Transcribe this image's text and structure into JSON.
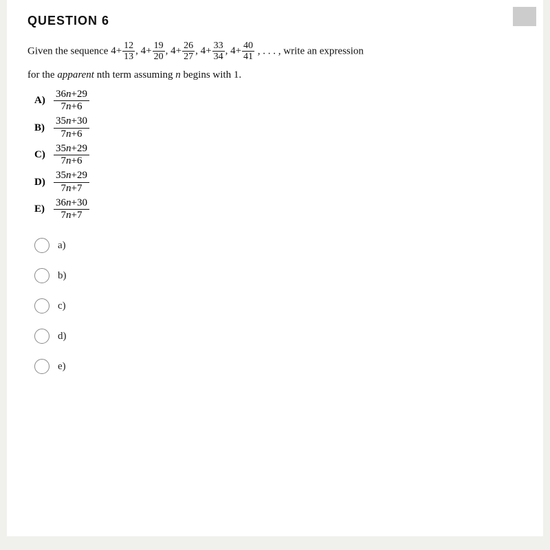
{
  "title": "QUESTION 6",
  "question": {
    "intro": "Given the sequence",
    "sequence": [
      {
        "whole": "4+",
        "num": "12",
        "den": "13"
      },
      {
        "whole": "4+",
        "num": "19",
        "den": "20"
      },
      {
        "whole": "4+",
        "num": "26",
        "den": "27"
      },
      {
        "whole": "4+",
        "num": "33",
        "den": "34"
      },
      {
        "whole": "4+",
        "num": "40",
        "den": "41"
      }
    ],
    "continuation": "…,",
    "suffix": "write an expression",
    "line2_part1": "for the",
    "line2_italic": "apparent",
    "line2_part2": "nth term assuming",
    "line2_italic2": "n",
    "line2_part3": "begins with 1."
  },
  "choices": [
    {
      "label": "A)",
      "num": "36n+29",
      "den": "7n+6"
    },
    {
      "label": "B)",
      "num": "35n+30",
      "den": "7n+6"
    },
    {
      "label": "C)",
      "num": "35n+29",
      "den": "7n+6"
    },
    {
      "label": "D)",
      "num": "35n+29",
      "den": "7n+7"
    },
    {
      "label": "E)",
      "num": "36n+30",
      "den": "7n+7"
    }
  ],
  "radio_options": [
    {
      "id": "a",
      "label": "a)"
    },
    {
      "id": "b",
      "label": "b)"
    },
    {
      "id": "c",
      "label": "c)"
    },
    {
      "id": "d",
      "label": "d)"
    },
    {
      "id": "e",
      "label": "e)"
    }
  ],
  "button_label": ""
}
